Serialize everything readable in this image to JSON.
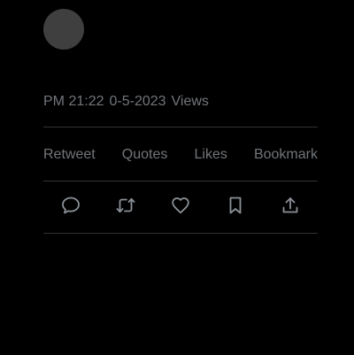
{
  "tweet": {
    "meta": {
      "time": "PM 21:22",
      "date": "0-5-2023",
      "views_label": "Views"
    },
    "stats": {
      "retweet_label": "Retweet",
      "quotes_label": "Quotes",
      "likes_label": "Likes",
      "bookmark_label": "Bookmark"
    },
    "actions": [
      {
        "name": "reply",
        "icon": "reply-icon"
      },
      {
        "name": "retweet",
        "icon": "retweet-icon"
      },
      {
        "name": "like",
        "icon": "heart-icon"
      },
      {
        "name": "bookmark",
        "icon": "bookmark-icon"
      },
      {
        "name": "share",
        "icon": "share-icon"
      }
    ],
    "colors": {
      "background": "#000000",
      "avatar": "#3f3f3f",
      "muted_text": "#71767b",
      "divider": "#2f3336",
      "icon": "#8b9197"
    }
  }
}
